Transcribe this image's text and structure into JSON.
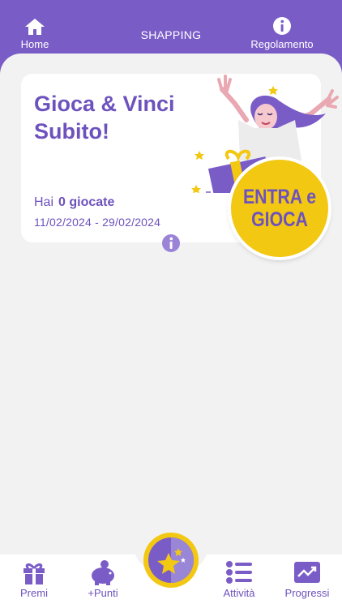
{
  "header": {
    "home_label": "Home",
    "title": "SHAPPING",
    "rules_label": "Regolamento"
  },
  "card": {
    "title": "Gioca & Vinci Subito!",
    "plays_prefix": "Hai",
    "plays_value": "0 giocate",
    "date_range": "11/02/2024 - 29/02/2024",
    "cta_line1": "ENTRA e",
    "cta_line2": "GIOCA"
  },
  "tabbar": {
    "items": [
      {
        "label": "Premi",
        "icon": "gift-icon"
      },
      {
        "label": "+Punti",
        "icon": "piggy-bank-icon"
      },
      {
        "label": "",
        "icon": "stars-icon"
      },
      {
        "label": "Attività",
        "icon": "list-icon"
      },
      {
        "label": "Progressi",
        "icon": "trend-chart-icon"
      }
    ]
  },
  "colors": {
    "brand_purple": "#7a5cc7",
    "text_purple": "#6d52bd",
    "accent_yellow": "#f2c812",
    "background": "#f2f2f2"
  }
}
